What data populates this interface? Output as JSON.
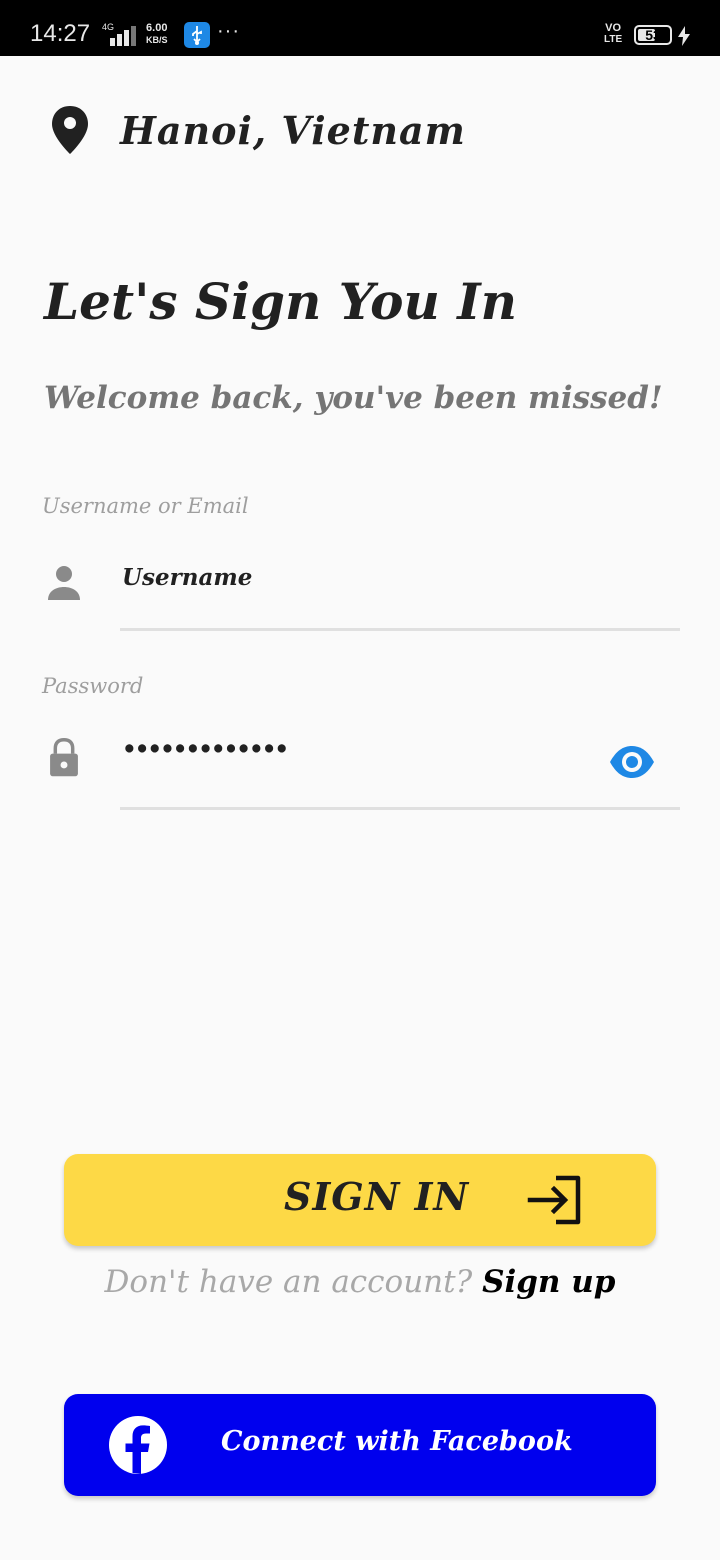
{
  "status_bar": {
    "time": "14:27",
    "network": "4G",
    "speed_value": "6.00",
    "speed_unit": "KB/S",
    "more": "···",
    "volte_top": "VO",
    "volte_bottom": "LTE",
    "battery": "53"
  },
  "location": {
    "icon": "location-pin-icon",
    "city": "Hanoi, Vietnam"
  },
  "header": {
    "title": "Let's Sign You In",
    "subtitle": "Welcome back, you've been missed!"
  },
  "form": {
    "username": {
      "label": "Username or Email",
      "value": "Username",
      "icon": "person-icon"
    },
    "password": {
      "label": "Password",
      "value": "•••••••••••••",
      "icon": "lock-icon",
      "toggle_icon": "eye-icon"
    }
  },
  "actions": {
    "sign_in_label": "SIGN IN",
    "sign_in_icon": "login-icon",
    "signup_prompt": "Don't have an account?",
    "signup_link": "Sign up",
    "facebook_label": "Connect with Facebook",
    "facebook_icon": "facebook-icon"
  },
  "colors": {
    "background": "#fafafa",
    "sign_in_button": "#fdd946",
    "facebook_button": "#0000ee",
    "eye_icon": "#1e88e5",
    "underline": "#e0e0e0"
  }
}
